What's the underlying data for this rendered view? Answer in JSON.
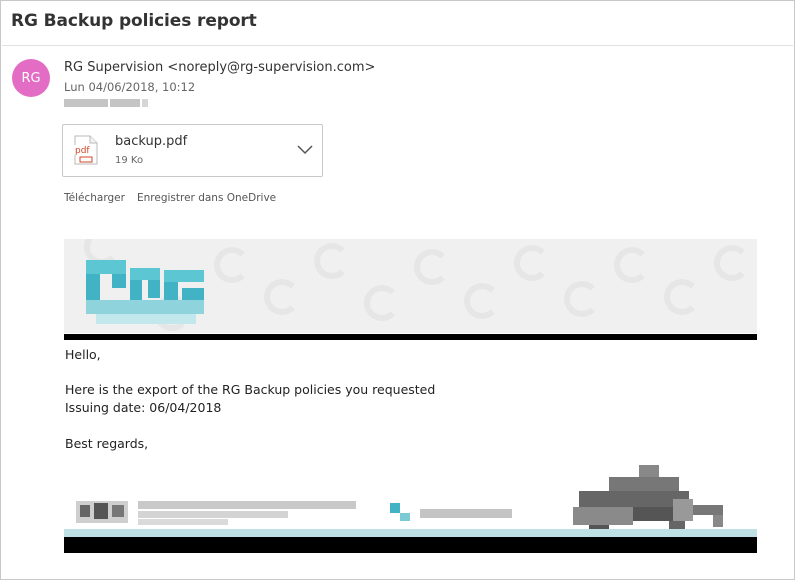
{
  "email": {
    "subject": "RG Backup policies report",
    "avatar_initials": "RG",
    "avatar_color": "#e36cc4",
    "sender": "RG Supervision <noreply@rg-supervision.com>",
    "date": "Lun 04/06/2018, 10:12"
  },
  "attachment": {
    "icon": "pdf-file-icon",
    "icon_text": "pdf",
    "filename": "backup.pdf",
    "size": "19 Ko"
  },
  "actions": {
    "download": "Télécharger",
    "onedrive": "Enregistrer dans OneDrive"
  },
  "body": {
    "greeting": "Hello,",
    "line1": "Here is the export of the RG Backup policies you requested",
    "line2": "Issuing date: 06/04/2018",
    "closing": "Best regards,"
  },
  "colors": {
    "accent_teal": "#41b3c4",
    "rule_black": "#000000"
  }
}
